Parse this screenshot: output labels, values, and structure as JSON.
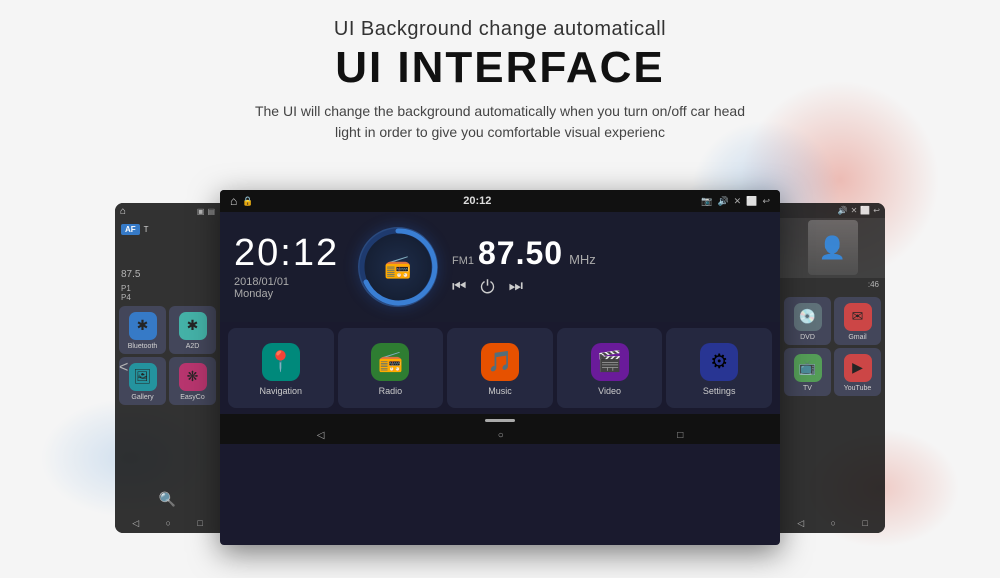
{
  "header": {
    "subtitle": "UI Background change automaticall",
    "title": "UI INTERFACE",
    "desc_line1": "The UI will change the background automatically when you turn on/off car head",
    "desc_line2": "light in order to give you comfortable visual experienc"
  },
  "main_screen": {
    "status_bar": {
      "home_icon": "⌂",
      "lock_icon": "🔒",
      "time": "20:12",
      "icons": [
        "📷",
        "🔊",
        "✕",
        "⬜",
        "↩"
      ]
    },
    "clock": {
      "time": "20:12",
      "date": "2018/01/01",
      "day": "Monday"
    },
    "radio": {
      "label": "FM1",
      "freq": "87.50",
      "unit": "MHz"
    },
    "apps": [
      {
        "label": "Navigation",
        "icon": "📍",
        "bg": "bg-teal"
      },
      {
        "label": "Radio",
        "icon": "📻",
        "bg": "bg-green"
      },
      {
        "label": "Music",
        "icon": "🎵",
        "bg": "bg-orange"
      },
      {
        "label": "Video",
        "icon": "🎬",
        "bg": "bg-purple"
      },
      {
        "label": "Settings",
        "icon": "⚙",
        "bg": "bg-indigo"
      }
    ]
  },
  "left_screen": {
    "apps": [
      {
        "label": "Bluetooth",
        "icon": "✱",
        "bg": "bg-blue"
      },
      {
        "label": "A2D",
        "icon": "✱",
        "bg": "bg-teal2"
      },
      {
        "label": "Gallery",
        "icon": "🖼",
        "bg": "bg-cyan"
      },
      {
        "label": "EasyCo",
        "icon": "❋",
        "bg": "bg-pink"
      }
    ]
  },
  "right_screen": {
    "apps": [
      {
        "label": "DVD",
        "icon": "💿",
        "bg": "bg-grey"
      },
      {
        "label": "Gmail",
        "icon": "✉",
        "bg": "bg-red"
      },
      {
        "label": "TV",
        "icon": "📺",
        "bg": "bg-green2"
      },
      {
        "label": "YouTube",
        "icon": "▶",
        "bg": "bg-red"
      }
    ]
  }
}
